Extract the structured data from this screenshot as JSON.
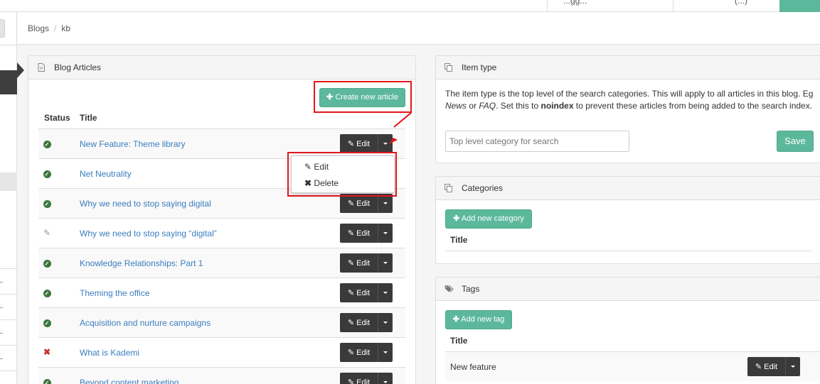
{
  "topbar": {
    "item_a": "...gg...",
    "item_b": "(...)"
  },
  "breadcrumb": {
    "root": "Blogs",
    "separator": "/",
    "current": "kb"
  },
  "blog_articles": {
    "heading": "Blog Articles",
    "create_button": "Create new article",
    "col_status": "Status",
    "col_title": "Title",
    "edit_label": "Edit",
    "rows": [
      {
        "status": "published",
        "title": "New Feature: Theme library"
      },
      {
        "status": "published",
        "title": "Net Neutrality"
      },
      {
        "status": "published",
        "title": "Why we need to stop saying digital"
      },
      {
        "status": "draft",
        "title": "Why we need to stop saying “digital”"
      },
      {
        "status": "published",
        "title": "Knowledge Relationships: Part 1"
      },
      {
        "status": "published",
        "title": "Theming the office"
      },
      {
        "status": "published",
        "title": "Acquisition and nurture campaigns"
      },
      {
        "status": "unpublished",
        "title": "What is Kademi"
      },
      {
        "status": "published",
        "title": "Beyond content marketing"
      }
    ]
  },
  "dropdown": {
    "edit": "Edit",
    "delete": "Delete"
  },
  "item_type": {
    "heading": "Item type",
    "desc_1": "The item type is the top level of the search categories. This will apply to all articles in this blog. Eg ",
    "desc_news": "News",
    "desc_or": " or ",
    "desc_faq": "FAQ",
    "desc_2": ". Set this to ",
    "desc_noindex": "noindex",
    "desc_3": " to prevent these articles from being added to the search index.",
    "placeholder": "Top level category for search",
    "save": "Save"
  },
  "categories": {
    "heading": "Categories",
    "add_button": "Add new category",
    "col_title": "Title"
  },
  "tags": {
    "heading": "Tags",
    "add_button": "Add new tag",
    "col_title": "Title",
    "rows": [
      {
        "title": "New feature"
      }
    ],
    "edit_label": "Edit"
  },
  "colors": {
    "accent_green": "#5cb89b",
    "dark_button": "#3a3a3a",
    "link": "#3a7dbf",
    "annotation_red": "#e1171c"
  }
}
